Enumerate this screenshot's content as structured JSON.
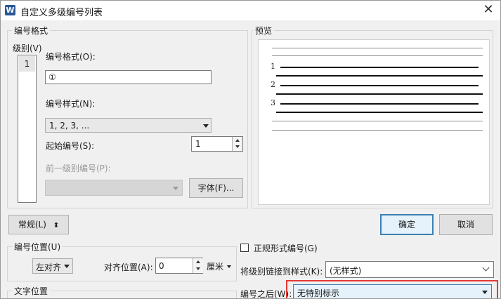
{
  "window": {
    "title": "自定义多级编号列表",
    "app_icon_letter": "W",
    "close_glyph": "✕"
  },
  "number_format_group": {
    "legend": "编号格式",
    "level_label": "级别(V)",
    "levels": [
      "1"
    ],
    "format_label": "编号格式(O):",
    "format_value": "①",
    "style_label": "编号样式(N):",
    "style_value": "1, 2, 3, ...",
    "start_label": "起始编号(S):",
    "start_value": "1",
    "prev_level_label": "前一级别编号(P):",
    "prev_level_value": "",
    "font_button": "字体(F)..."
  },
  "preview_group": {
    "legend": "预览",
    "numbers": [
      "1",
      "2",
      "3"
    ]
  },
  "buttons": {
    "normal": "常规(L)",
    "normal_icon": "⬍",
    "ok": "确定",
    "cancel": "取消"
  },
  "number_position_group": {
    "legend": "编号位置(U)",
    "align_value": "左对齐",
    "align_position_label": "对齐位置(A):",
    "align_position_value": "0",
    "unit": "厘米"
  },
  "text_position_group": {
    "legend": "文字位置"
  },
  "options": {
    "legal_numbering_label": "正规形式编号(G)",
    "legal_numbering_checked": false,
    "link_label": "将级别链接到样式(K):",
    "link_value": "(无样式)",
    "after_number_label": "编号之后(W):",
    "after_number_value": "无特别标示"
  },
  "colors": {
    "highlight": "#e53935",
    "default_button_border": "#3c7fb1",
    "app_icon": "#2b5797"
  }
}
